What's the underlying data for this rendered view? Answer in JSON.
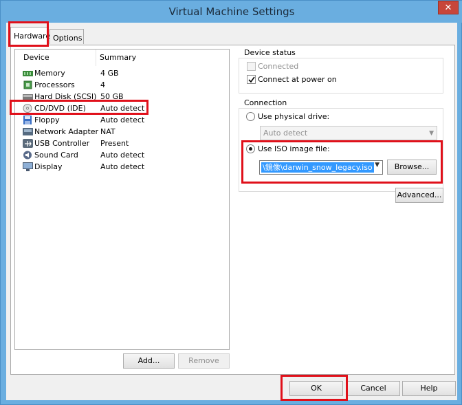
{
  "window": {
    "title": "Virtual Machine Settings",
    "close_glyph": "✕"
  },
  "tabs": [
    {
      "label": "Hardware",
      "active": true
    },
    {
      "label": "Options",
      "active": false
    }
  ],
  "devices": {
    "headers": {
      "device": "Device",
      "summary": "Summary"
    },
    "rows": [
      {
        "name": "Memory",
        "summary": "4 GB",
        "icon": "memory-icon"
      },
      {
        "name": "Processors",
        "summary": "4",
        "icon": "processor-icon"
      },
      {
        "name": "Hard Disk (SCSI)",
        "summary": "50 GB",
        "icon": "hard-disk-icon"
      },
      {
        "name": "CD/DVD (IDE)",
        "summary": "Auto detect",
        "icon": "cd-dvd-icon"
      },
      {
        "name": "Floppy",
        "summary": "Auto detect",
        "icon": "floppy-icon"
      },
      {
        "name": "Network Adapter",
        "summary": "NAT",
        "icon": "network-adapter-icon"
      },
      {
        "name": "USB Controller",
        "summary": "Present",
        "icon": "usb-icon"
      },
      {
        "name": "Sound Card",
        "summary": "Auto detect",
        "icon": "sound-card-icon"
      },
      {
        "name": "Display",
        "summary": "Auto detect",
        "icon": "display-icon"
      }
    ]
  },
  "buttons": {
    "add": "Add...",
    "remove": "Remove",
    "ok": "OK",
    "cancel": "Cancel",
    "help": "Help",
    "browse": "Browse...",
    "advanced": "Advanced..."
  },
  "device_status": {
    "label": "Device status",
    "connected": "Connected",
    "connected_checked": false,
    "power_on": "Connect at power on",
    "power_on_checked": true
  },
  "connection": {
    "label": "Connection",
    "physical": "Use physical drive:",
    "physical_selected": false,
    "physical_value": "Auto detect",
    "iso": "Use ISO image file:",
    "iso_selected": true,
    "iso_value": "\\鏡像\\darwin_snow_legacy.iso"
  },
  "colors": {
    "highlight": "#e0101a",
    "selection": "#3399ff"
  }
}
